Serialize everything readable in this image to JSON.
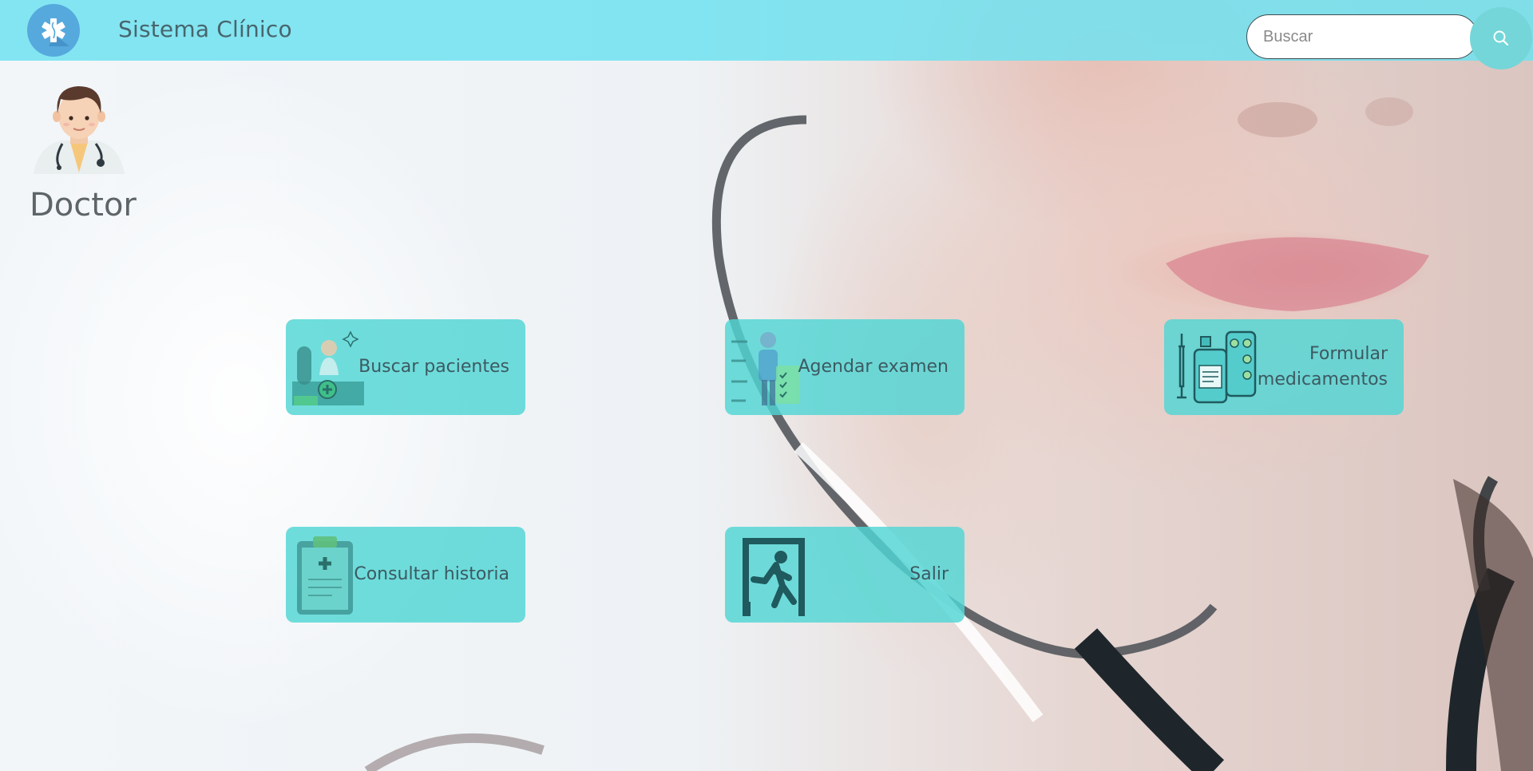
{
  "header": {
    "app_title": "Sistema Clínico",
    "logo_icon": "medical-star-icon",
    "search": {
      "placeholder": "Buscar",
      "value": "",
      "icon": "search-icon"
    }
  },
  "profile": {
    "role": "Doctor",
    "avatar_icon": "doctor-avatar-icon"
  },
  "menu": [
    {
      "label": "Buscar pacientes",
      "icon": "doctor-desk-icon"
    },
    {
      "label": "Agendar examen",
      "icon": "patient-checklist-icon"
    },
    {
      "label": "Formular medicamentos",
      "icon": "medicine-bottle-icon"
    },
    {
      "label": "Consultar historia",
      "icon": "clipboard-icon"
    },
    {
      "label": "Salir",
      "icon": "exit-door-icon"
    }
  ],
  "colors": {
    "header": "#70e2f0",
    "card": "#50d6d4",
    "logo": "#55a9dd",
    "text": "#3c5a61"
  }
}
